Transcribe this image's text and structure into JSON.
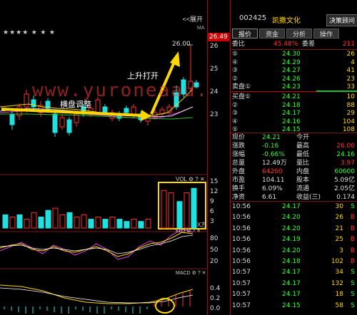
{
  "top_bar": {
    "collapse_label": "<<展开",
    "stars": "★★★★  ★  ★   ★",
    "ma_label": "MA"
  },
  "price_chart": {
    "annotation_top": "上升打开",
    "annotation_mid": "横盘调整",
    "peak_label": "26.00",
    "price_badge": "26.49",
    "y_ticks": [
      "26",
      "25",
      "24",
      "23"
    ],
    "watermark": "www.yuroneaau.com"
  },
  "vol_panel": {
    "label": "VOL",
    "y_ticks": [
      "15",
      "12",
      "9",
      "6",
      "3"
    ],
    "unit": "X万"
  },
  "kdj_panel": {
    "label": "KDJ",
    "y_ticks": [
      "80",
      "50",
      "20"
    ]
  },
  "macd_panel": {
    "label": "MACD",
    "y_ticks": [
      "0.4",
      "0.2",
      "0.0"
    ]
  },
  "panel_icons": {
    "gear": "⚙",
    "help": "?",
    "close": "✕"
  },
  "stock": {
    "code": "002425",
    "name": "凯撒文化",
    "decision_btn": "决策顾问"
  },
  "tabs": [
    "报价",
    "资金",
    "分析",
    "操作"
  ],
  "order_book": {
    "ratio_label": "委比",
    "ratio_value": "45.48%",
    "diff_label": "委差",
    "diff_value": "211",
    "sells": [
      {
        "label": "⑤",
        "price": "24.30",
        "vol": "26"
      },
      {
        "label": "④",
        "price": "24.29",
        "vol": "4"
      },
      {
        "label": "③",
        "price": "24.27",
        "vol": "41"
      },
      {
        "label": "②",
        "price": "24.26",
        "vol": "23"
      },
      {
        "label": "卖盘①",
        "price": "24.23",
        "vol": "33"
      }
    ],
    "buys": [
      {
        "label": "买盘①",
        "price": "24.21",
        "vol": "10"
      },
      {
        "label": "②",
        "price": "24.18",
        "vol": "88"
      },
      {
        "label": "③",
        "price": "24.17",
        "vol": "29"
      },
      {
        "label": "④",
        "price": "24.16",
        "vol": "104"
      },
      {
        "label": "⑤",
        "price": "24.15",
        "vol": "108"
      }
    ]
  },
  "quote": [
    {
      "l1": "现价",
      "v1": "24.21",
      "l2": "今开",
      "v2": ""
    },
    {
      "l1": "涨跌",
      "v1": "-0.16",
      "l2": "最高",
      "v2": "26.00"
    },
    {
      "l1": "涨幅",
      "v1": "-0.66%",
      "l2": "最低",
      "v2": "24.16"
    },
    {
      "l1": "总量",
      "v1": "12.49万",
      "l2": "量比",
      "v2": "3.97"
    },
    {
      "l1": "外盘",
      "v1": "64260",
      "l2": "内盘",
      "v2": "60600"
    },
    {
      "l1": "市盈",
      "v1": "104.11",
      "l2": "股本",
      "v2": "5.09亿"
    },
    {
      "l1": "换手",
      "v1": "6.09%",
      "l2": "流通",
      "v2": "2.05亿"
    },
    {
      "l1": "净资",
      "v1": "6.61",
      "l2": "收益(三)",
      "v2": "0.174"
    }
  ],
  "ticks": [
    {
      "time": "10:56",
      "price": "24.17",
      "vol": "30",
      "side": "S"
    },
    {
      "time": "10:56",
      "price": "24.20",
      "vol": "26",
      "side": "B"
    },
    {
      "time": "10:56",
      "price": "24.20",
      "vol": "21",
      "side": "B"
    },
    {
      "time": "10:56",
      "price": "24.19",
      "vol": "25",
      "side": "B"
    },
    {
      "time": "10:56",
      "price": "24.20",
      "vol": "3",
      "side": "B"
    },
    {
      "time": "10:56",
      "price": "24.18",
      "vol": "102",
      "side": "B"
    },
    {
      "time": "10:57",
      "price": "24.17",
      "vol": "34",
      "side": "S"
    },
    {
      "time": "10:57",
      "price": "24.17",
      "vol": "132",
      "side": "S"
    },
    {
      "time": "10:57",
      "price": "24.17",
      "vol": "18",
      "side": "S"
    },
    {
      "time": "10:57",
      "price": "24.15",
      "vol": "58",
      "side": "S"
    }
  ]
}
